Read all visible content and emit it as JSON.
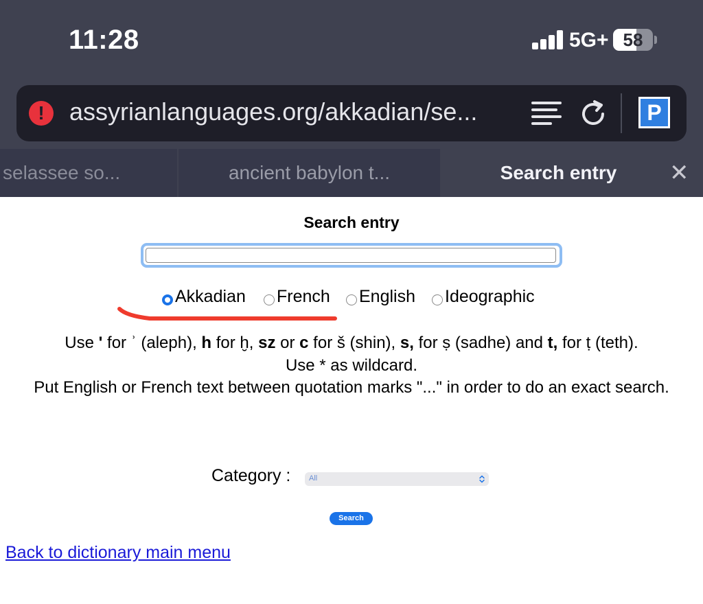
{
  "status_bar": {
    "time": "11:28",
    "network": "5G+",
    "battery": "58",
    "battery_level": 0.58
  },
  "address_bar": {
    "url": "assyrianlanguages.org/akkadian/se...",
    "security_icon": "warning-icon",
    "reader_icon": "reader-view-icon",
    "reload_icon": "reload-icon",
    "extension_icon": "p-extension-icon",
    "extension_letter": "P"
  },
  "tabs": [
    {
      "title": "selassee so..."
    },
    {
      "title": "ancient babylon t..."
    },
    {
      "title": "Search entry",
      "active": true
    }
  ],
  "tab_close": "✕",
  "page": {
    "title": "Search entry",
    "search_value": "",
    "languages": [
      {
        "label": "Akkadian",
        "checked": true
      },
      {
        "label": "French",
        "checked": false
      },
      {
        "label": "English",
        "checked": false
      },
      {
        "label": "Ideographic",
        "checked": false
      }
    ],
    "help_lines": {
      "line1": {
        "a": "Use ",
        "b": "'",
        "c": " for ʾ (aleph), ",
        "d": "h",
        "e": " for ḫ, ",
        "f": "sz",
        "g": " or ",
        "h": "c",
        "i": " for š (shin), ",
        "j": "s,",
        "k": " for ṣ (sadhe) and ",
        "l": "t,",
        "m": " for ṭ (teth)."
      },
      "line2": "Use * as wildcard.",
      "line3": "Put English or French text between quotation marks \"...\" in order to do an exact search."
    },
    "category_label": "Category :",
    "category_value": "All",
    "search_button": "Search",
    "back_link": "Back to dictionary main menu"
  },
  "colors": {
    "chrome_bg": "#3f4150",
    "urlbar_bg": "#1e1e28",
    "accent": "#1a73e8",
    "annotation": "#ef3b2d",
    "link": "#1a1ad8"
  }
}
